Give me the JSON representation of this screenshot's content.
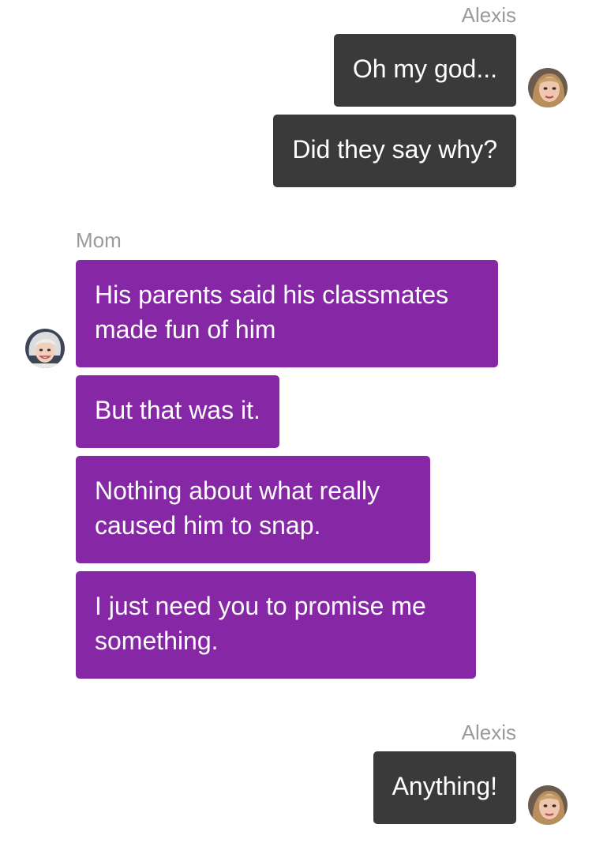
{
  "conversation": {
    "groups": [
      {
        "sender": "Alexis",
        "side": "right",
        "messages": [
          "Oh my god...",
          "Did they say why?"
        ]
      },
      {
        "sender": "Mom",
        "side": "left",
        "messages": [
          "His parents said his classmates made fun of him",
          "But that was it.",
          "Nothing about what really caused him to snap.",
          "I just need you to promise me something."
        ]
      },
      {
        "sender": "Alexis",
        "side": "right",
        "messages": [
          "Anything!"
        ]
      }
    ]
  },
  "colors": {
    "outgoing_bubble": "#3a3a3a",
    "incoming_bubble": "#8628a6",
    "sender_name": "#9a9a9a",
    "background": "#ffffff"
  },
  "avatars": {
    "alexis": "alexis-avatar-icon",
    "mom": "mom-avatar-icon"
  }
}
